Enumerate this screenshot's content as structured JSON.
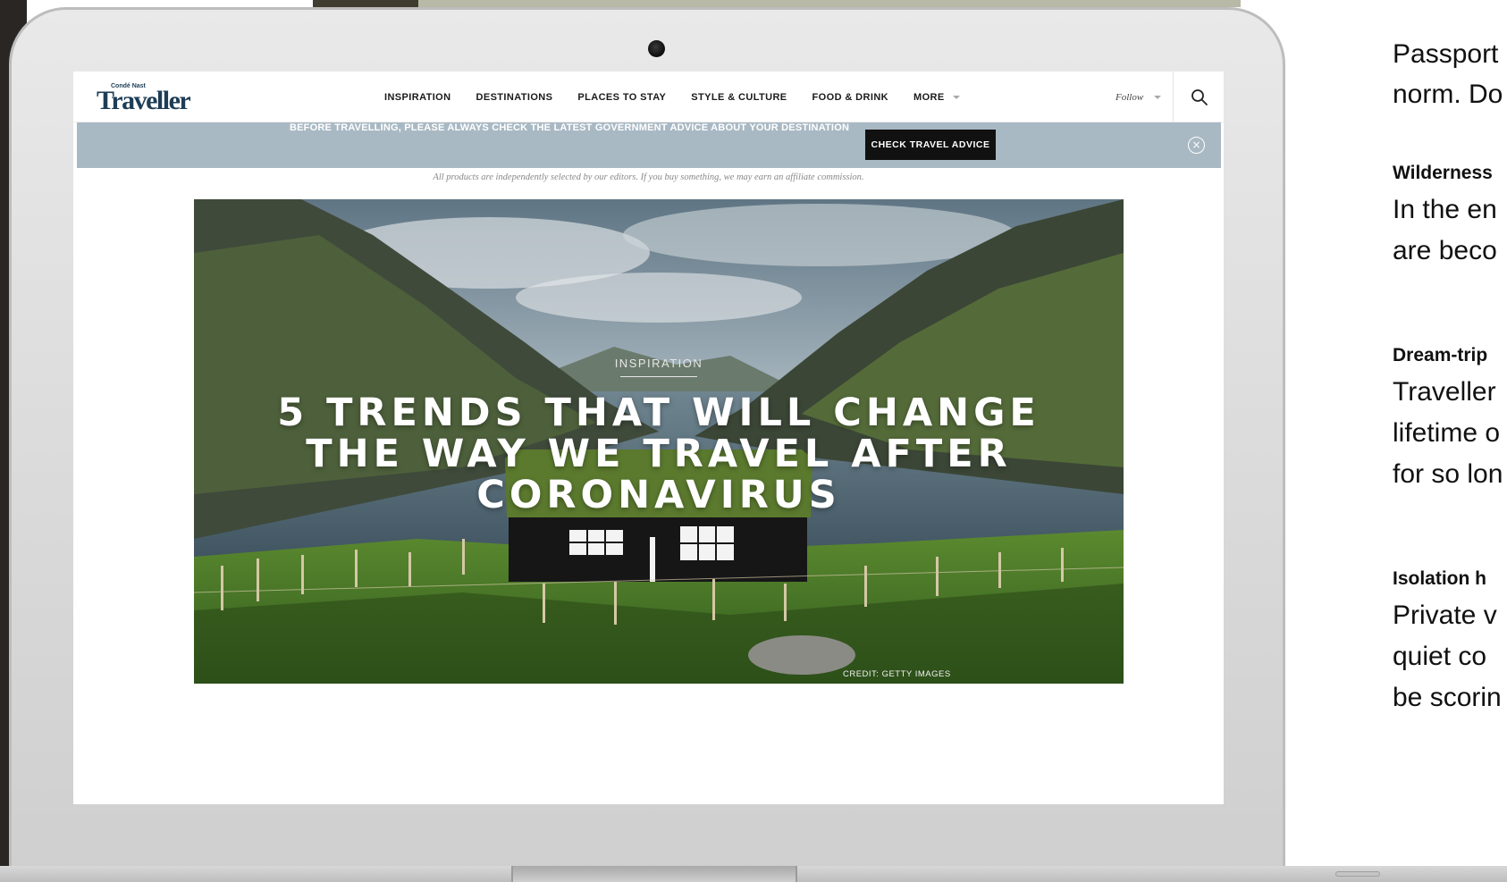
{
  "site": {
    "logo_small": "Condé Nast",
    "logo_main": "Traveller"
  },
  "nav": {
    "items": [
      "INSPIRATION",
      "DESTINATIONS",
      "PLACES TO STAY",
      "STYLE & CULTURE",
      "FOOD & DRINK",
      "MORE"
    ],
    "follow_label": "Follow"
  },
  "advice_banner": {
    "text": "BEFORE TRAVELLING, PLEASE ALWAYS CHECK THE LATEST GOVERNMENT ADVICE ABOUT YOUR DESTINATION",
    "button_label": "CHECK TRAVEL ADVICE"
  },
  "affiliate_notice": "All products are independently selected by our editors. If you buy something, we may earn an affiliate commission.",
  "hero": {
    "category": "INSPIRATION",
    "title_lines": [
      "5 TRENDS THAT WILL CHANGE",
      "THE WAY WE TRAVEL AFTER",
      "CORONAVIRUS"
    ],
    "credit": "CREDIT: GETTY IMAGES"
  },
  "side_article": {
    "top_lines": [
      "Passport",
      "norm. Do"
    ],
    "sections": [
      {
        "heading": "Wilderness",
        "lines": [
          "In the en",
          "are beco"
        ]
      },
      {
        "heading": "Dream-trip",
        "lines": [
          "Traveller",
          "lifetime o",
          "for so lon"
        ]
      },
      {
        "heading": "Isolation h",
        "lines": [
          "Private v",
          "quiet co",
          "be scorin"
        ]
      }
    ]
  }
}
